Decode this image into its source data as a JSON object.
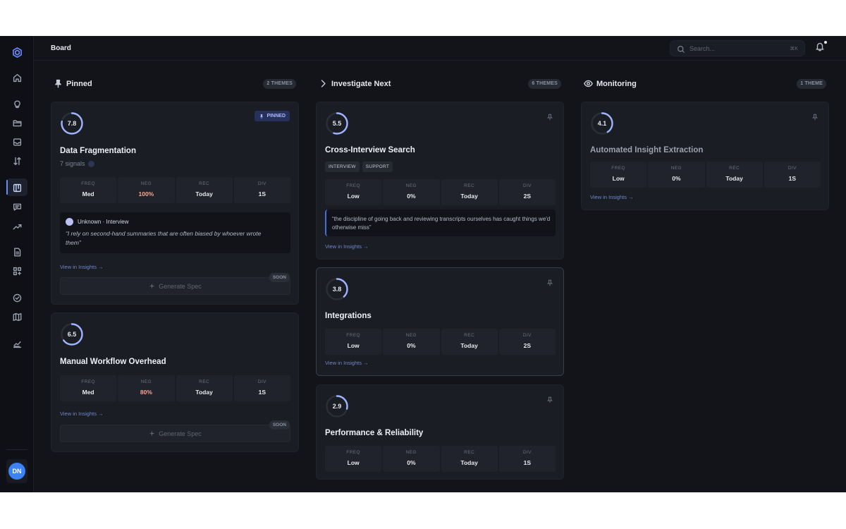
{
  "app": {
    "page_title": "Board",
    "search_placeholder": "Search...",
    "search_shortcut": "⌘K",
    "user_initials": "DN",
    "colors": {
      "accent": "#6b8cff",
      "avatar": "#3b82f6",
      "negative_high": "#f6a58f"
    }
  },
  "sidebar": {
    "items": [
      {
        "icon": "logo-icon"
      },
      {
        "icon": "home-icon"
      },
      {
        "icon": "lightbulb-icon"
      },
      {
        "icon": "folder-icon"
      },
      {
        "icon": "inbox-icon"
      },
      {
        "icon": "sort-icon"
      },
      {
        "icon": "board-icon",
        "active": true
      },
      {
        "icon": "chat-icon"
      },
      {
        "icon": "trend-icon"
      },
      {
        "icon": "document-icon"
      },
      {
        "icon": "grid-plus-icon"
      },
      {
        "icon": "check-circle-icon"
      },
      {
        "icon": "map-icon"
      },
      {
        "icon": "chart-icon"
      }
    ]
  },
  "columns": [
    {
      "title": "Pinned",
      "icon": "pin-icon",
      "badge": "2 THEMES",
      "cards": [
        {
          "score": "7.8",
          "score_fraction": 0.78,
          "pinned_label": "PINNED",
          "title": "Data Fragmentation",
          "signals": "7 signals",
          "stats": [
            {
              "label": "FREQ",
              "value": "Med"
            },
            {
              "label": "NEG",
              "value": "100%"
            },
            {
              "label": "REC",
              "value": "Today"
            },
            {
              "label": "DIV",
              "value": "1S"
            }
          ],
          "quote_source": "Unknown · Interview",
          "quote": "“I rely on second-hand summaries that are often biased by whoever wrote them”",
          "view_link": "View in Insights →",
          "spec_label": "Generate Spec",
          "soon_label": "SOON"
        },
        {
          "score": "6.5",
          "score_fraction": 0.65,
          "title": "Manual Workflow Overhead",
          "stats": [
            {
              "label": "FREQ",
              "value": "Med"
            },
            {
              "label": "NEG",
              "value": "80%"
            },
            {
              "label": "REC",
              "value": "Today"
            },
            {
              "label": "DIV",
              "value": "1S"
            }
          ],
          "view_link": "View in Insights →",
          "spec_label": "Generate Spec",
          "soon_label": "SOON"
        }
      ]
    },
    {
      "title": "Investigate Next",
      "icon": "chevron-right-icon",
      "badge": "6 THEMES",
      "cards": [
        {
          "score": "5.5",
          "score_fraction": 0.55,
          "title": "Cross-Interview Search",
          "tags": [
            "INTERVIEW",
            "SUPPORT"
          ],
          "stats": [
            {
              "label": "FREQ",
              "value": "Low"
            },
            {
              "label": "NEG",
              "value": "0%"
            },
            {
              "label": "REC",
              "value": "Today"
            },
            {
              "label": "DIV",
              "value": "2S"
            }
          ],
          "quote": "“the discipline of going back and reviewing transcripts ourselves has caught things we'd otherwise miss”",
          "view_link": "View in Insights →"
        },
        {
          "score": "3.8",
          "score_fraction": 0.38,
          "title": "Integrations",
          "stats": [
            {
              "label": "FREQ",
              "value": "Low"
            },
            {
              "label": "NEG",
              "value": "0%"
            },
            {
              "label": "REC",
              "value": "Today"
            },
            {
              "label": "DIV",
              "value": "2S"
            }
          ],
          "view_link": "View in Insights →"
        },
        {
          "score": "2.9",
          "score_fraction": 0.29,
          "title": "Performance & Reliability",
          "stats": [
            {
              "label": "FREQ",
              "value": "Low"
            },
            {
              "label": "NEG",
              "value": "0%"
            },
            {
              "label": "REC",
              "value": "Today"
            },
            {
              "label": "DIV",
              "value": "1S"
            }
          ]
        }
      ]
    },
    {
      "title": "Monitoring",
      "icon": "eye-icon",
      "badge": "1 THEME",
      "cards": [
        {
          "score": "4.1",
          "score_fraction": 0.41,
          "title": "Automated Insight Extraction",
          "stats": [
            {
              "label": "FREQ",
              "value": "Low"
            },
            {
              "label": "NEG",
              "value": "0%"
            },
            {
              "label": "REC",
              "value": "Today"
            },
            {
              "label": "DIV",
              "value": "1S"
            }
          ],
          "view_link": "View in Insights →"
        }
      ]
    }
  ]
}
